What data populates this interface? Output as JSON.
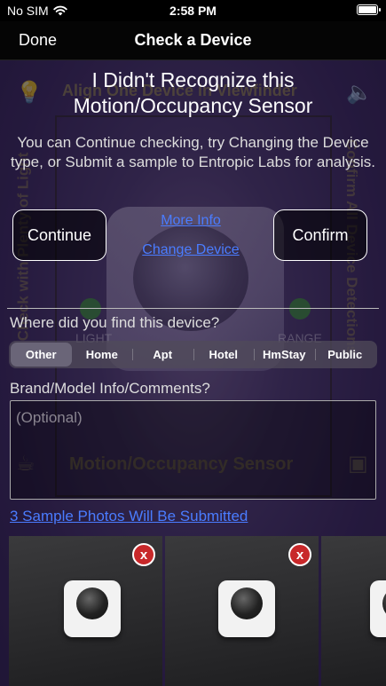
{
  "status_bar": {
    "carrier": "No SIM",
    "time": "2:58 PM"
  },
  "nav": {
    "done_label": "Done",
    "title": "Check a Device"
  },
  "camera_overlay": {
    "top_text": "Align One Device in Viewfinder",
    "left_vertical": "Check with Plenty of Light",
    "right_vertical": "Confirm All Device Detections",
    "light_label": "LIGHT",
    "range_label": "RANGE",
    "detection_label": "Motion/Occupancy Sensor"
  },
  "message": {
    "headline_line1": "I Didn't Recognize this",
    "headline_line2": "Motion/Occupancy Sensor",
    "body": "You can Continue checking, try Changing the Device type, or Submit a sample to Entropic Labs for analysis."
  },
  "actions": {
    "continue_label": "Continue",
    "confirm_label": "Confirm",
    "more_info_label": "More Info",
    "change_device_label": "Change Device"
  },
  "location": {
    "question": "Where did you find this device?",
    "options": [
      "Other",
      "Home",
      "Apt",
      "Hotel",
      "HmStay",
      "Public"
    ],
    "selected": "Other"
  },
  "comments": {
    "label": "Brand/Model Info/Comments?",
    "placeholder": "(Optional)"
  },
  "photos": {
    "summary_link": "3 Sample Photos Will Be Submitted",
    "remove_glyph": "x"
  },
  "colors": {
    "link": "#4a7cff",
    "remove_badge": "#c8282a",
    "background": "#2a1d45"
  }
}
